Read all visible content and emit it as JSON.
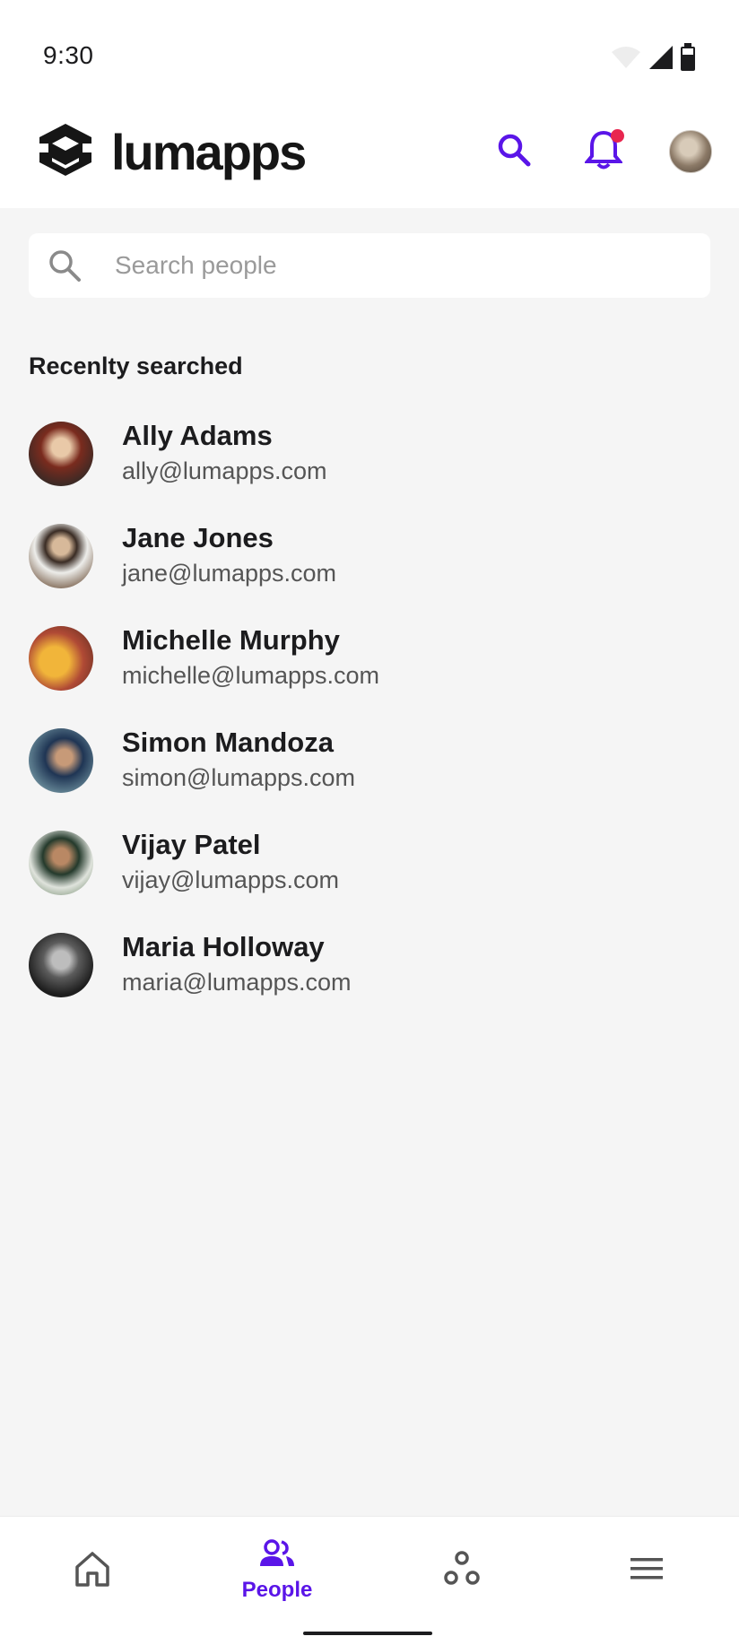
{
  "status_bar": {
    "time": "9:30",
    "icons": [
      "wifi-icon",
      "signal-icon",
      "battery-icon"
    ]
  },
  "app_bar": {
    "logo_text": "lumapps",
    "actions": [
      "search-icon",
      "bell-icon",
      "avatar"
    ],
    "notification_dot_color": "#e8264f"
  },
  "search": {
    "placeholder": "Search people",
    "value": ""
  },
  "recent": {
    "title": "Recenlty searched",
    "people": [
      {
        "name": "Ally Adams",
        "email": "ally@lumapps.com"
      },
      {
        "name": "Jane Jones",
        "email": "jane@lumapps.com"
      },
      {
        "name": "Michelle Murphy",
        "email": "michelle@lumapps.com"
      },
      {
        "name": "Simon Mandoza",
        "email": "simon@lumapps.com"
      },
      {
        "name": "Vijay Patel",
        "email": "vijay@lumapps.com"
      },
      {
        "name": "Maria Holloway",
        "email": "maria@lumapps.com"
      }
    ]
  },
  "bottom_nav": {
    "items": [
      {
        "icon": "home-icon",
        "label": ""
      },
      {
        "icon": "people-icon",
        "label": "People",
        "active": true
      },
      {
        "icon": "communities-icon",
        "label": ""
      },
      {
        "icon": "menu-icon",
        "label": ""
      }
    ]
  },
  "colors": {
    "accent": "#5a15e8",
    "background": "#f5f5f5",
    "surface": "#ffffff",
    "text_primary": "#1c1c1e",
    "text_secondary": "#555555"
  }
}
